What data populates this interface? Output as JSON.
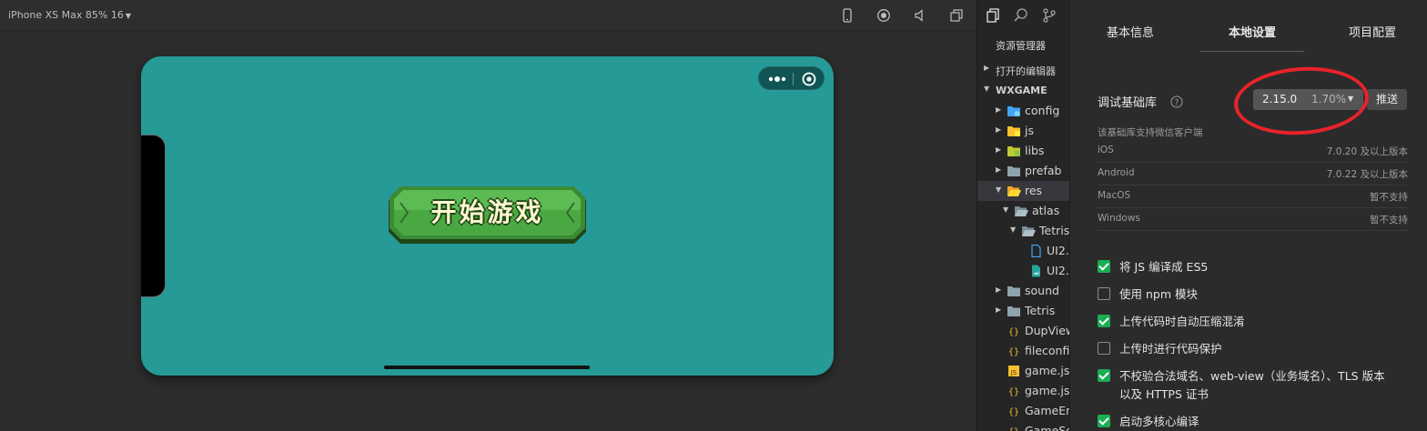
{
  "simulator": {
    "device_label": "iPhone XS Max 85% 16",
    "toolbar_icons": [
      "phone-icon",
      "record-icon",
      "mute-icon",
      "window-icon"
    ],
    "game": {
      "background": "#259a97",
      "start_button_label": "开始游戏",
      "capsule_icons": [
        "more-icon",
        "close-target-icon"
      ]
    }
  },
  "explorer": {
    "tab_icons": [
      "files-icon",
      "search-icon",
      "git-branch-icon"
    ],
    "title": "资源管理器",
    "sections": {
      "open_editors": "打开的编辑器",
      "project": "WXGAME"
    },
    "tree": [
      {
        "name": "config",
        "type": "folder-config",
        "depth": 1,
        "expanded": false
      },
      {
        "name": "js",
        "type": "folder-js",
        "depth": 1,
        "expanded": false
      },
      {
        "name": "libs",
        "type": "folder-lib",
        "depth": 1,
        "expanded": false
      },
      {
        "name": "prefab",
        "type": "folder",
        "depth": 1,
        "expanded": false
      },
      {
        "name": "res",
        "type": "folder-open-res",
        "depth": 1,
        "expanded": true,
        "selected": true
      },
      {
        "name": "atlas",
        "type": "folder-open",
        "depth": 2,
        "expanded": true
      },
      {
        "name": "Tetris",
        "type": "folder-open",
        "depth": 3,
        "expanded": true
      },
      {
        "name": "UI2.",
        "type": "file",
        "depth": 4
      },
      {
        "name": "UI2.",
        "type": "image-file",
        "depth": 4
      },
      {
        "name": "sound",
        "type": "folder",
        "depth": 1,
        "expanded": false
      },
      {
        "name": "Tetris",
        "type": "folder",
        "depth": 1,
        "expanded": false
      },
      {
        "name": "DupView",
        "type": "json",
        "depth": 1
      },
      {
        "name": "fileconfi",
        "type": "json",
        "depth": 1
      },
      {
        "name": "game.js",
        "type": "js",
        "depth": 1
      },
      {
        "name": "game.js",
        "type": "json",
        "depth": 1
      },
      {
        "name": "GameEn",
        "type": "json",
        "depth": 1
      },
      {
        "name": "GameSc",
        "type": "json",
        "depth": 1
      }
    ]
  },
  "settings": {
    "tabs": [
      "基本信息",
      "本地设置",
      "项目配置"
    ],
    "active_tab": "本地设置",
    "lib_label": "调试基础库",
    "version": "2.15.0",
    "version_share": "1.70%",
    "push_label": "推送",
    "support_note": "该基础库支持微信客户端",
    "clients": [
      {
        "platform": "iOS",
        "requirement": "7.0.20 及以上版本"
      },
      {
        "platform": "Android",
        "requirement": "7.0.22 及以上版本"
      },
      {
        "platform": "MacOS",
        "requirement": "暂不支持"
      },
      {
        "platform": "Windows",
        "requirement": "暂不支持"
      }
    ],
    "options": [
      {
        "label": "将 JS 编译成 ES5",
        "checked": true
      },
      {
        "label": "使用 npm 模块",
        "checked": false
      },
      {
        "label": "上传代码时自动压缩混淆",
        "checked": true
      },
      {
        "label": "上传时进行代码保护",
        "checked": false
      },
      {
        "label": "不校验合法域名、web-view（业务域名）、TLS 版本以及 HTTPS 证书",
        "checked": true
      },
      {
        "label": "启动多核心编译",
        "checked": true
      }
    ],
    "accent": "#1aad54",
    "highlight": "#e8232a"
  }
}
